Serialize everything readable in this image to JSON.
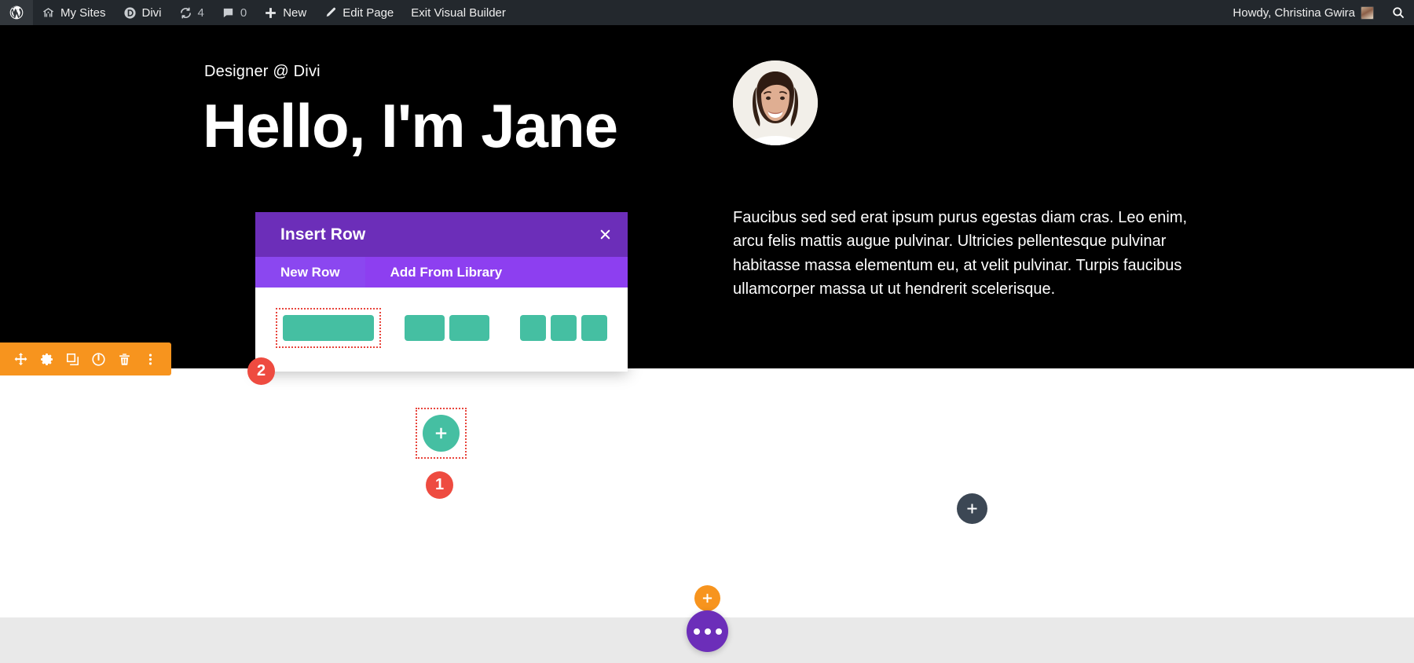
{
  "adminbar": {
    "wp_logo_icon": "wordpress-logo-icon",
    "items": [
      {
        "icon": "multisite-icon",
        "label": "My Sites"
      },
      {
        "icon": "divi-logo-icon",
        "label": "Divi"
      },
      {
        "icon": "updates-icon",
        "label": "4"
      },
      {
        "icon": "comments-icon",
        "label": "0"
      },
      {
        "icon": "plus-icon",
        "label": "New"
      },
      {
        "icon": "pencil-icon",
        "label": "Edit Page"
      },
      {
        "icon": "",
        "label": "Exit Visual Builder"
      }
    ],
    "howdy": "Howdy, Christina Gwira",
    "avatar_icon": "user-avatar",
    "search_icon": "search-icon"
  },
  "hero": {
    "eyebrow": "Designer @ Divi",
    "title": "Hello, I'm Jane",
    "avatar_icon": "profile-photo",
    "body": "Faucibus sed sed erat ipsum purus egestas diam cras. Leo enim, arcu felis mattis augue pulvinar. Ultricies pellentesque pulvinar habitasse massa elementum eu, at velit pulvinar. Turpis faucibus ullamcorper massa ut ut hendrerit scelerisque."
  },
  "section_toolbar": {
    "buttons": [
      {
        "icon": "move-icon",
        "name": "move-section-button"
      },
      {
        "icon": "gear-icon",
        "name": "section-settings-button"
      },
      {
        "icon": "duplicate-icon",
        "name": "duplicate-section-button"
      },
      {
        "icon": "power-icon",
        "name": "disable-section-button"
      },
      {
        "icon": "trash-icon",
        "name": "delete-section-button"
      },
      {
        "icon": "kebab-icon",
        "name": "section-more-button"
      }
    ]
  },
  "insert_row_modal": {
    "title": "Insert Row",
    "close_icon": "close-icon",
    "tabs": [
      {
        "label": "New Row",
        "active": true
      },
      {
        "label": "Add From Library",
        "active": false
      }
    ],
    "layouts": [
      {
        "name": "one-column",
        "columns": [
          1
        ],
        "highlighted": true
      },
      {
        "name": "two-column",
        "columns": [
          2,
          2
        ],
        "highlighted": false
      },
      {
        "name": "three-column",
        "columns": [
          3,
          3,
          3
        ],
        "highlighted": false
      }
    ]
  },
  "add_row_button": {
    "icon": "plus-icon",
    "highlighted": true
  },
  "add_module_button": {
    "icon": "plus-icon"
  },
  "bottom_controls": {
    "add_section_icon": "plus-icon",
    "builder_menu_icon": "ellipsis-icon"
  },
  "step_badges": [
    {
      "number": "1",
      "target": "add-row-button"
    },
    {
      "number": "2",
      "target": "one-column-layout"
    }
  ],
  "colors": {
    "admin_bar": "#23282d",
    "hero_bg": "#000000",
    "divi_orange": "#f7941e",
    "divi_purple": "#6c2eb9",
    "tab_purple": "#8d3ff0",
    "divi_green": "#45bfa2",
    "badge_red": "#ee4b40",
    "dark_slate": "#3c4754",
    "gray_section": "#e9e9e9"
  }
}
